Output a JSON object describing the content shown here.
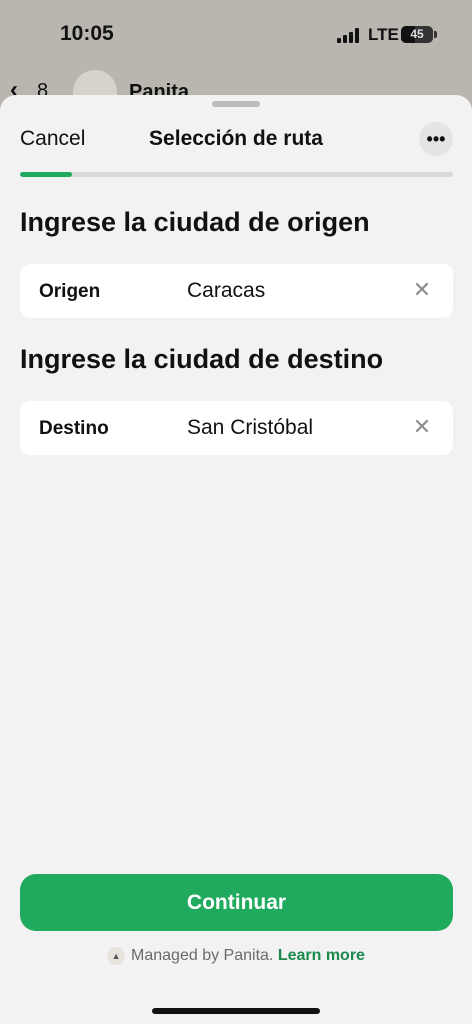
{
  "status_bar": {
    "time": "10:05",
    "network": "LTE",
    "battery": "45",
    "battery_level": 0.45
  },
  "background_chat": {
    "back_count": "8",
    "contact_name": "Panita"
  },
  "sheet": {
    "cancel_label": "Cancel",
    "title": "Selección de ruta",
    "more_icon": "ellipsis-icon",
    "progress": 0.12
  },
  "origin": {
    "heading": "Ingrese la ciudad de origen",
    "label": "Origen",
    "value": "Caracas"
  },
  "destination": {
    "heading": "Ingrese la ciudad de destino",
    "label": "Destino",
    "value": "San Cristóbal"
  },
  "continue_label": "Continuar",
  "footer": {
    "managed_text": "Managed by Panita.",
    "learn_more": "Learn more"
  },
  "colors": {
    "accent": "#1faa5e",
    "sheet_bg": "#f2f2f2"
  }
}
